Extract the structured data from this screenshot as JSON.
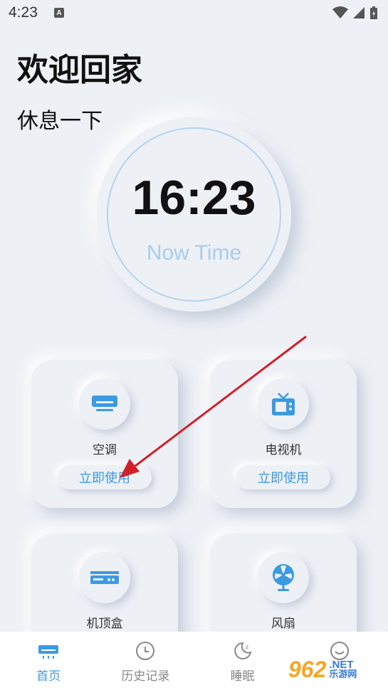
{
  "status_bar": {
    "time": "4:23",
    "notification_letter": "A"
  },
  "header": {
    "title": "欢迎回家",
    "subtitle": "休息一下"
  },
  "clock": {
    "time": "16:23",
    "label": "Now Time"
  },
  "devices": [
    {
      "name": "空调",
      "button": "立即使用",
      "icon": "air-conditioner-icon"
    },
    {
      "name": "电视机",
      "button": "立即使用",
      "icon": "tv-icon"
    },
    {
      "name": "机顶盒",
      "icon": "set-top-box-icon"
    },
    {
      "name": "风扇",
      "icon": "fan-icon"
    }
  ],
  "nav": [
    {
      "label": "首页",
      "icon": "home-device-icon",
      "active": true
    },
    {
      "label": "历史记录",
      "icon": "clock-icon",
      "active": false
    },
    {
      "label": "睡眠",
      "icon": "moon-icon",
      "active": false
    },
    {
      "label": "",
      "icon": "smiley-icon",
      "active": false
    }
  ],
  "watermark": {
    "number": "962",
    "suffix": ".NET",
    "text": "乐游网"
  },
  "colors": {
    "accent": "#3b9ae1",
    "background": "#edf0f5",
    "clock_ring": "#b6d4ef",
    "arrow": "#d0202a"
  }
}
